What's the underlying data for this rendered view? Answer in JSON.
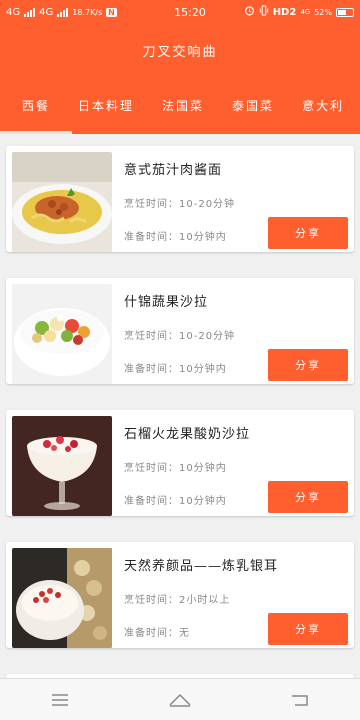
{
  "status_bar": {
    "carrier1": "4G",
    "carrier2": "4G",
    "speed": "18.7K/s",
    "notif_badge": "N",
    "time": "15:20",
    "network": "HD2",
    "network_small": "4G",
    "battery": "52%"
  },
  "app": {
    "title": "刀叉交响曲"
  },
  "tabs": [
    {
      "label": "西餐",
      "active": true
    },
    {
      "label": "日本料理",
      "active": false
    },
    {
      "label": "法国菜",
      "active": false
    },
    {
      "label": "泰国菜",
      "active": false
    },
    {
      "label": "意大利",
      "active": false
    }
  ],
  "recipes": [
    {
      "title": "意式茄汁肉酱面",
      "cook_time": "烹饪时间：10-20分钟",
      "prep_time": "准备时间：10分钟内",
      "share_label": "分享",
      "image": "pasta-bolognese"
    },
    {
      "title": "什锦蔬果沙拉",
      "cook_time": "烹饪时间：10-20分钟",
      "prep_time": "准备时间：10分钟内",
      "share_label": "分享",
      "image": "mixed-fruit-salad"
    },
    {
      "title": "石榴火龙果酸奶沙拉",
      "cook_time": "烹饪时间：10分钟内",
      "prep_time": "准备时间：10分钟内",
      "share_label": "分享",
      "image": "pomegranate-yogurt-glass"
    },
    {
      "title": "天然养颜品——炼乳银耳",
      "cook_time": "烹饪时间：2小时以上",
      "prep_time": "准备时间：无",
      "share_label": "分享",
      "image": "tremella-condensed-milk"
    }
  ],
  "colors": {
    "accent": "#ff5f2e",
    "background": "#f0f0f0"
  }
}
